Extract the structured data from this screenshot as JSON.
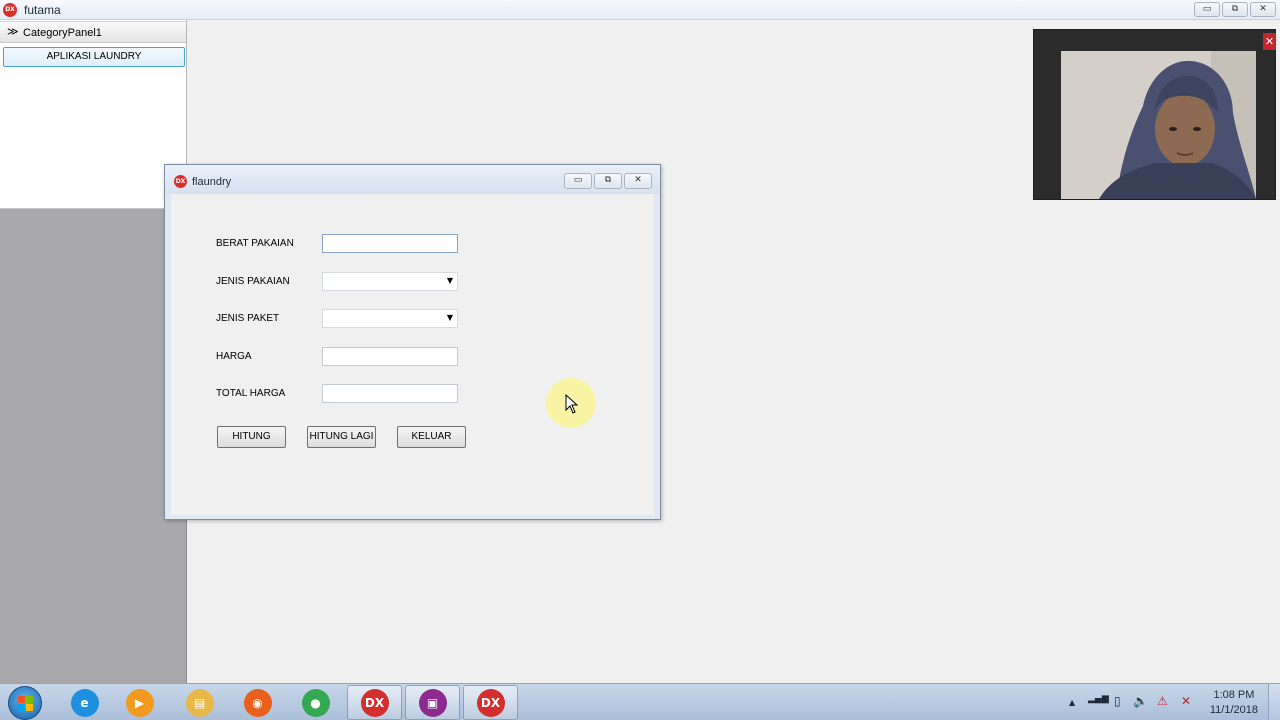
{
  "main_window": {
    "icon_text": "DX",
    "title": "futama",
    "minimize_glyph": "▭",
    "restore_glyph": "⧉",
    "close_glyph": "✕"
  },
  "category_panel": {
    "header_chevron": "≫",
    "header_label": "CategoryPanel1",
    "items": [
      {
        "label": "APLIKASI LAUNDRY"
      }
    ]
  },
  "dialog": {
    "icon_text": "DX",
    "title": "flaundry",
    "minimize_glyph": "▭",
    "restore_glyph": "⧉",
    "close_glyph": "✕",
    "fields": {
      "berat_pakaian": {
        "label": "BERAT PAKAIAN",
        "value": ""
      },
      "jenis_pakaian": {
        "label": "JENIS PAKAIAN",
        "value": "",
        "arrow": "▼"
      },
      "jenis_paket": {
        "label": "JENIS PAKET",
        "value": "",
        "arrow": "▼"
      },
      "harga": {
        "label": "HARGA",
        "value": ""
      },
      "total_harga": {
        "label": "TOTAL HARGA",
        "value": ""
      }
    },
    "buttons": {
      "hitung": "HITUNG",
      "hitung_lagi": "HITUNG LAGI",
      "keluar": "KELUAR"
    }
  },
  "webcam": {
    "close_glyph": "✕"
  },
  "taskbar": {
    "apps": [
      {
        "name": "internet-explorer",
        "glyph": "e",
        "color": "#1f8fe0"
      },
      {
        "name": "media-player",
        "glyph": "▶",
        "color": "#f29a1e"
      },
      {
        "name": "file-explorer",
        "glyph": "▤",
        "color": "#e6b94a"
      },
      {
        "name": "firefox",
        "glyph": "◉",
        "color": "#e8601c"
      },
      {
        "name": "chrome",
        "glyph": "●",
        "color": "#34a853"
      },
      {
        "name": "delphi-ide",
        "glyph": "DX",
        "color": "#d32f2f"
      },
      {
        "name": "screen-recorder",
        "glyph": "▣",
        "color": "#8e2a8e"
      },
      {
        "name": "delphi-app",
        "glyph": "DX",
        "color": "#d32f2f"
      }
    ],
    "tray": {
      "show_hidden": "▲",
      "signal": "▂▄▆",
      "battery": "▯",
      "volume": "🔈",
      "adobe": "⚠",
      "network": "✕"
    },
    "clock_time": "1:08 PM",
    "clock_date": "11/1/2018"
  }
}
